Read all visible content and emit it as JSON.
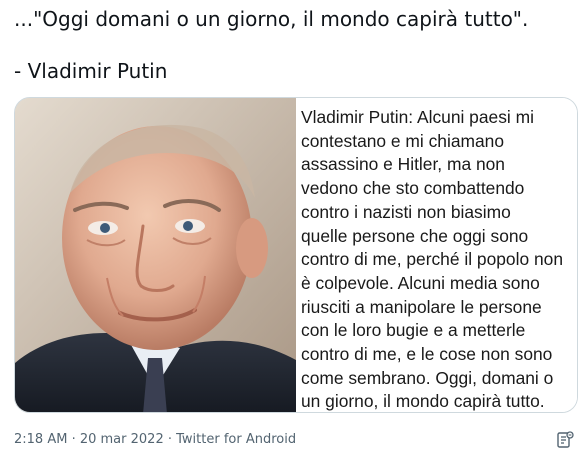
{
  "tweet": {
    "quote_line": "...\"Oggi domani o un giorno, il mondo capirà tutto\".",
    "attribution_line": "- Vladimir Putin"
  },
  "media": {
    "caption": "Vladimir Putin: Alcuni paesi mi\ncontestano e mi chiamano\nassassino e Hitler, ma non\nvedono che sto combattendo\ncontro i nazisti non biasimo\nquelle persone che oggi sono\ncontro di me, perché il popolo non\nè colpevole. Alcuni media sono\nriusciti a manipolare le persone\ncon le loro bugie e a metterle\ncontro di me, e le cose non sono\ncome sembrano. Oggi, domani o\nun giorno, il mondo capirà tutto."
  },
  "meta": {
    "time": "2:18 AM",
    "separator_1": " · ",
    "date": "20 mar 2022",
    "separator_2": " · ",
    "source": "Twitter for Android"
  },
  "icons": {
    "analytics": "analytics-icon"
  },
  "colors": {
    "text": "#0f1419",
    "secondary": "#536471",
    "border": "#cfd9de"
  }
}
